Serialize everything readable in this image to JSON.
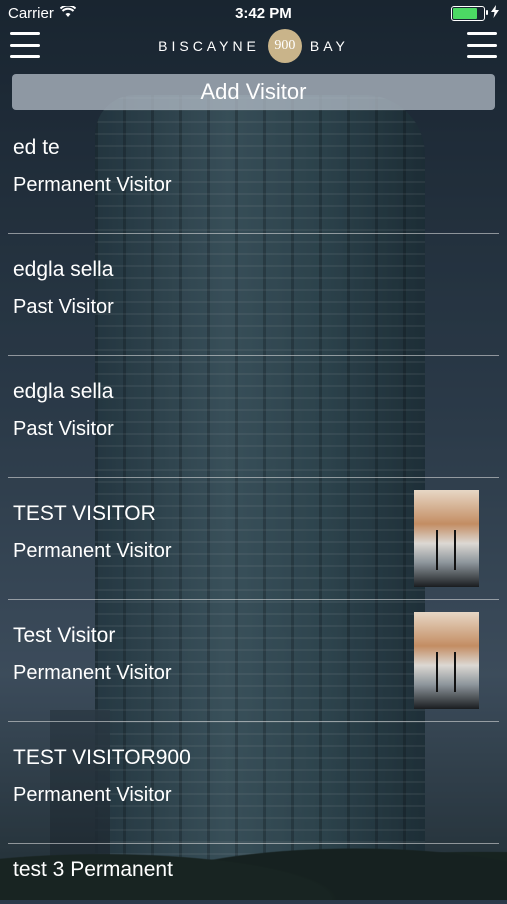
{
  "status": {
    "carrier": "Carrier",
    "time": "3:42 PM"
  },
  "header": {
    "logo_left": "BISCAYNE",
    "logo_badge": "900",
    "logo_right": "BAY"
  },
  "add_button_label": "Add Visitor",
  "visitors": [
    {
      "name": "ed te",
      "type": "Permanent Visitor",
      "has_photo": false
    },
    {
      "name": "edgla sella",
      "type": "Past Visitor",
      "has_photo": false
    },
    {
      "name": "edgla sella",
      "type": "Past Visitor",
      "has_photo": false
    },
    {
      "name": "TEST VISITOR",
      "type": "Permanent Visitor",
      "has_photo": true
    },
    {
      "name": "Test Visitor",
      "type": "Permanent Visitor",
      "has_photo": true
    },
    {
      "name": "TEST VISITOR900",
      "type": "Permanent Visitor",
      "has_photo": false
    },
    {
      "name": "test 3 Permanent",
      "type": "",
      "has_photo": false
    }
  ],
  "colors": {
    "battery": "#4cd964",
    "logo_badge": "#c9b48a"
  }
}
